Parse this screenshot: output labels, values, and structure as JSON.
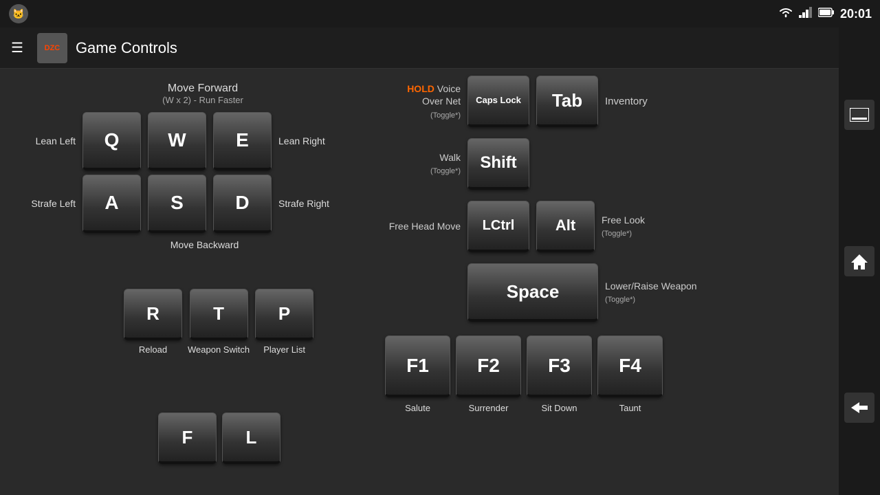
{
  "statusBar": {
    "time": "20:01",
    "wifiIcon": "wifi",
    "signalIcon": "signal",
    "batteryIcon": "battery"
  },
  "header": {
    "menuIcon": "☰",
    "appName": "DZC",
    "title": "Game Controls"
  },
  "sideNav": {
    "homeIcon": "⬜",
    "recentIcon": "⌂",
    "backIcon": "←"
  },
  "controls": {
    "holdLabel": "HOLD",
    "voiceOverNet": "Voice\nOver Net",
    "voiceToggle": "(Toggle*)",
    "capsLock": "Caps\nLock",
    "tab": "Tab",
    "inventory": "Inventory",
    "walk": "Walk",
    "walkToggle": "(Toggle*)",
    "shift": "Shift",
    "freeHeadMove": "Free Head\nMove",
    "lctrl": "LCtrl",
    "alt": "Alt",
    "freeLook": "Free Look",
    "freeLookToggle": "(Toggle*)",
    "space": "Space",
    "lowerRaiseWeapon": "Lower/Raise\nWeapon",
    "lowerToggle": "(Toggle*)",
    "moveForward": "Move Forward",
    "runFaster": "(W x 2) - Run Faster",
    "leanLeft": "Lean\nLeft",
    "leanRight": "Lean\nRight",
    "strafeLeft": "Strafe\nLeft",
    "strafeRight": "Strafe\nRight",
    "moveBackward": "Move\nBackward",
    "keys": {
      "Q": "Q",
      "W": "W",
      "E": "E",
      "A": "A",
      "S": "S",
      "D": "D",
      "R": "R",
      "T": "T",
      "P": "P",
      "F": "F",
      "L": "L",
      "F1": "F1",
      "F2": "F2",
      "F3": "F3",
      "F4": "F4"
    },
    "reload": "Reload",
    "weaponSwitch": "Weapon\nSwitch",
    "playerList": "Player\nList",
    "salute": "Salute",
    "surrender": "Surrender",
    "sitDown": "Sit Down",
    "taunt": "Taunt"
  }
}
